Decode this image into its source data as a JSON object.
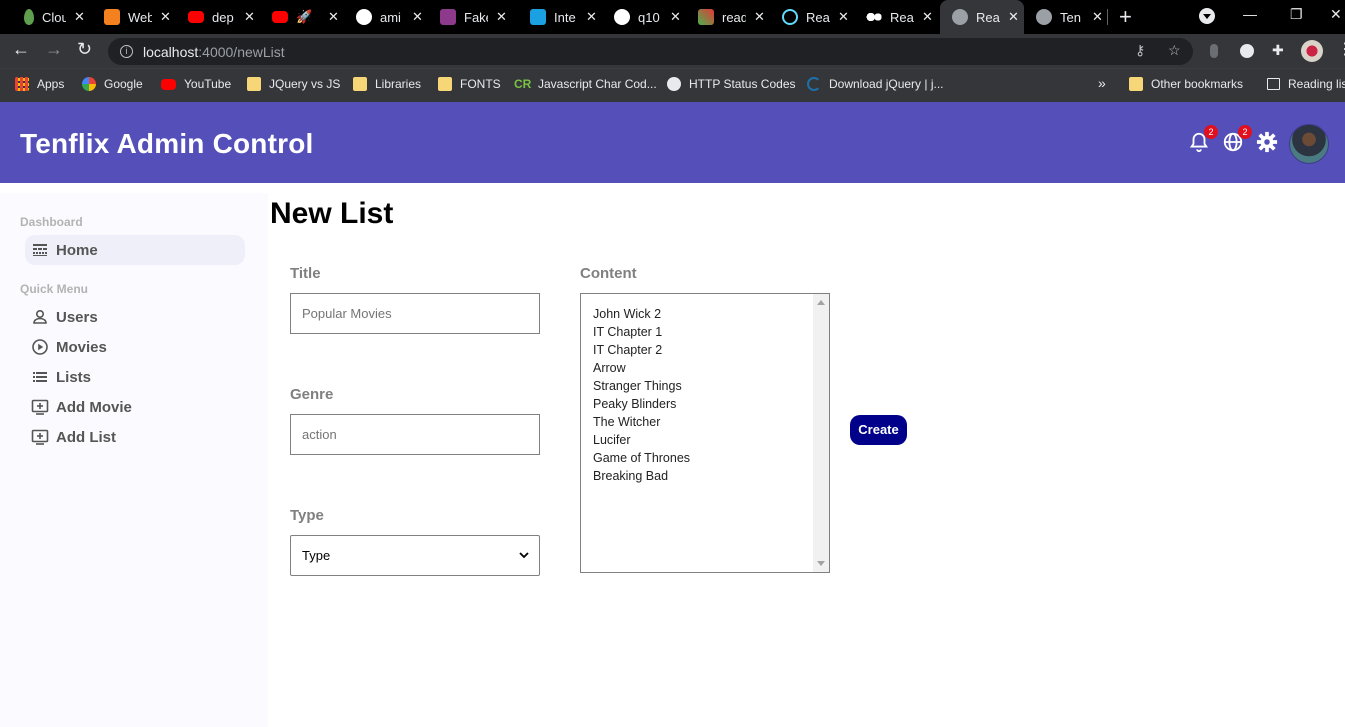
{
  "browser": {
    "tabs": [
      {
        "title": "Cloud",
        "color": "#5fa04e"
      },
      {
        "title": "Web",
        "color": "#f4801f"
      },
      {
        "title": "dep",
        "color": "#ff0000"
      },
      {
        "title": "🚀",
        "color": "#ff0000"
      },
      {
        "title": "ami",
        "color": "#ffffff"
      },
      {
        "title": "Fake",
        "color": "#8e3a8c"
      },
      {
        "title": "Inte",
        "color": "#1ba1e2"
      },
      {
        "title": "q10",
        "color": "#ffffff"
      },
      {
        "title": "read",
        "color": "#4caf50"
      },
      {
        "title": "Rea",
        "color": "#61dafb"
      },
      {
        "title": "Rea",
        "color": "#ffffff"
      },
      {
        "title": "Rea",
        "color": "#9aa0a6"
      },
      {
        "title": "Ten",
        "color": "#9aa0a6"
      }
    ],
    "active_tab_index": 11,
    "url_host": "localhost",
    "url_path": ":4000/newList",
    "bookmarks": [
      {
        "label": "Apps",
        "icon": "apps-grid-icon"
      },
      {
        "label": "Google",
        "icon": "google-icon"
      },
      {
        "label": "YouTube",
        "icon": "youtube-icon"
      },
      {
        "label": "JQuery vs JS",
        "icon": "folder-icon"
      },
      {
        "label": "Libraries",
        "icon": "folder-icon"
      },
      {
        "label": "FONTS",
        "icon": "folder-icon"
      },
      {
        "label": "Javascript Char Cod...",
        "icon": "cr-icon"
      },
      {
        "label": "HTTP Status Codes",
        "icon": "globe-icon"
      },
      {
        "label": "Download jQuery | j...",
        "icon": "jquery-icon"
      }
    ],
    "overflow_label": "»",
    "other_bookmarks": "Other bookmarks",
    "reading_list": "Reading list"
  },
  "app": {
    "logo": "Tenflix Admin Control",
    "notifications_count": "2",
    "language_count": "2"
  },
  "sidebar": {
    "dashboard_title": "Dashboard",
    "home": "Home",
    "quick_menu_title": "Quick Menu",
    "items": [
      "Users",
      "Movies",
      "Lists",
      "Add Movie",
      "Add List"
    ]
  },
  "form": {
    "page_title": "New List",
    "title_label": "Title",
    "title_placeholder": "Popular Movies",
    "genre_label": "Genre",
    "genre_placeholder": "action",
    "type_label": "Type",
    "type_selected": "Type",
    "content_label": "Content",
    "content_items": [
      "John Wick 2",
      "IT Chapter 1",
      "IT Chapter 2",
      "Arrow",
      "Stranger Things",
      "Peaky Blinders",
      "The Witcher",
      "Lucifer",
      "Game of Thrones",
      "Breaking Bad"
    ],
    "create_label": "Create"
  }
}
